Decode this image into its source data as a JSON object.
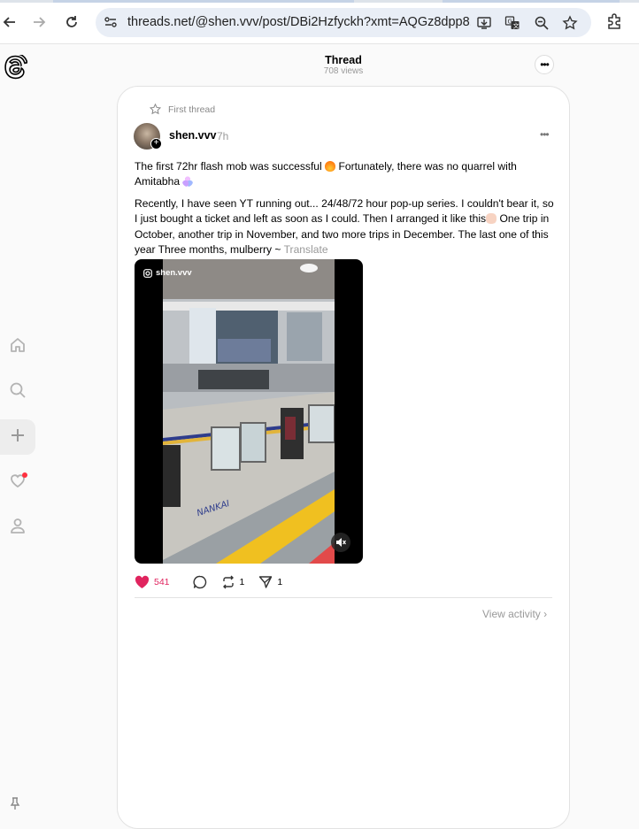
{
  "browser": {
    "url": "threads.net/@shen.vvv/post/DBi2Hzfyckh?xmt=AQGz8dpp8...",
    "icons": [
      "back-arrow-icon",
      "forward-arrow-icon",
      "reload-icon",
      "site-info-icon",
      "install-app-icon",
      "translate-page-icon",
      "zoom-icon",
      "bookmark-star-icon",
      "extensions-icon"
    ]
  },
  "sidebar": {
    "items": [
      {
        "name": "home-icon"
      },
      {
        "name": "search-icon"
      },
      {
        "name": "create-icon"
      },
      {
        "name": "activity-heart-icon"
      },
      {
        "name": "profile-icon"
      }
    ],
    "notification_color": "#ff3040"
  },
  "header": {
    "title": "Thread",
    "views": "708 views"
  },
  "post": {
    "first_thread_label": "First thread",
    "username": "shen.vvv",
    "time": "7h",
    "text1": "The first 72hr flash mob was successful",
    "text1b": " Fortunately, there was no quarrel with Amitabha",
    "text2": "Recently, I have seen YT running out... 24/48/72 hour pop-up series. I couldn't bear it, so I just bought a ticket and left as soon as I could. Then I arranged it like this",
    "text2b": " One trip in October, another trip in November, and two more trips in December. The last one of this year Three months, mulberry ~ ",
    "translate": "Translate",
    "media_tag": "shen.vvv",
    "likes": "541",
    "reposts": "1",
    "shares": "1",
    "view_activity": "View activity",
    "like_color": "#e0245e"
  }
}
